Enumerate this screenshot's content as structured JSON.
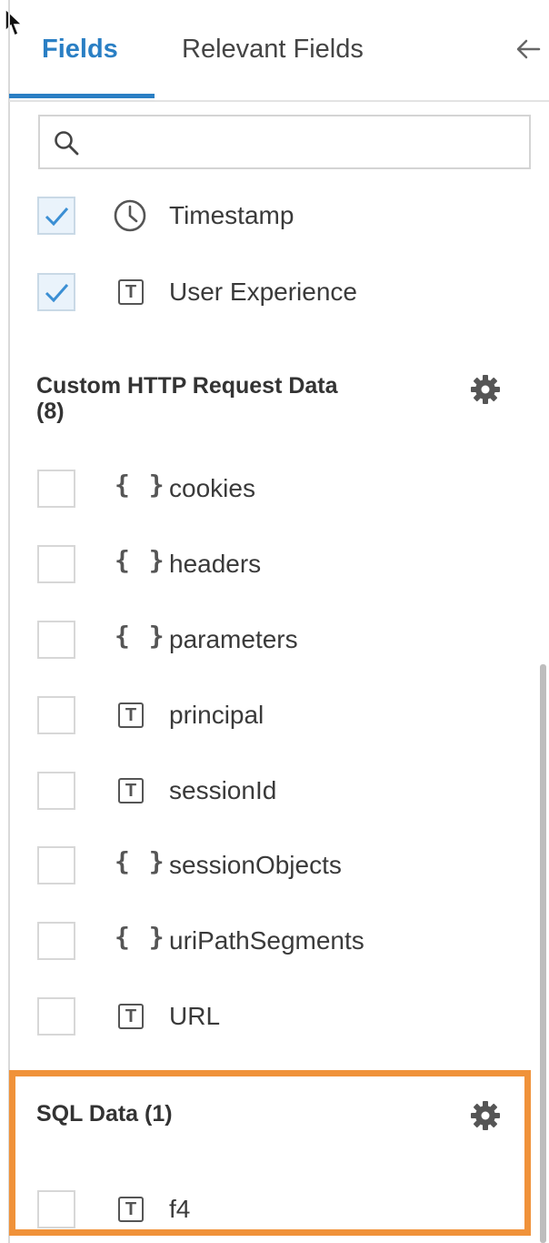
{
  "tabs": {
    "fields": "Fields",
    "relevant_fields": "Relevant Fields"
  },
  "search": {
    "placeholder": ""
  },
  "default_fields": [
    {
      "label": "Timestamp",
      "type_icon": "clock-icon",
      "checked": true
    },
    {
      "label": "User Experience",
      "type_icon": "text-type-icon",
      "checked": true
    }
  ],
  "custom_http": {
    "title": "Custom HTTP Request Data",
    "count": "(8)",
    "fields": [
      {
        "label": "cookies",
        "type_icon": "braces-icon",
        "checked": false
      },
      {
        "label": "headers",
        "type_icon": "braces-icon",
        "checked": false
      },
      {
        "label": "parameters",
        "type_icon": "braces-icon",
        "checked": false
      },
      {
        "label": "principal",
        "type_icon": "text-type-icon",
        "checked": false
      },
      {
        "label": "sessionId",
        "type_icon": "text-type-icon",
        "checked": false
      },
      {
        "label": "sessionObjects",
        "type_icon": "braces-icon",
        "checked": false
      },
      {
        "label": "uriPathSegments",
        "type_icon": "braces-icon",
        "checked": false
      },
      {
        "label": "URL",
        "type_icon": "text-type-icon",
        "checked": false
      }
    ]
  },
  "sql": {
    "title": "SQL Data (1)",
    "fields": [
      {
        "label": "f4",
        "type_icon": "text-type-icon",
        "checked": false
      }
    ]
  },
  "icons": {
    "braces": "{ }",
    "text_type": "T"
  },
  "colors": {
    "accent": "#2a7fc4",
    "highlight": "#f0923a"
  }
}
